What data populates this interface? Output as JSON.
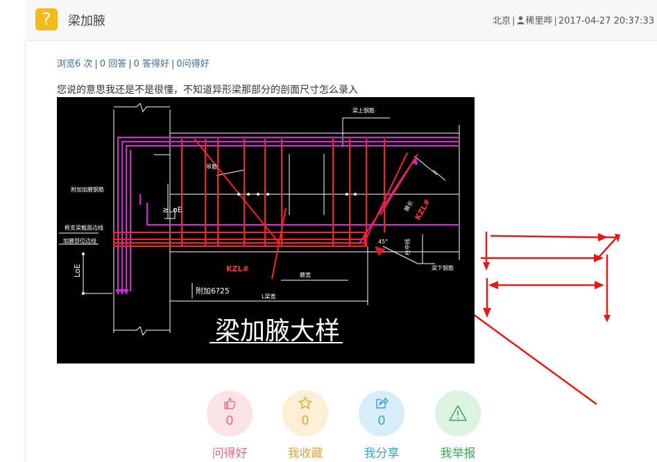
{
  "header": {
    "badge": "?",
    "title": "梁加腋",
    "location": "北京",
    "user": "稀里哗",
    "datetime": "2017-04-27 20:37:33"
  },
  "stats": {
    "views": "浏览6 次",
    "answers": "0 回答",
    "good_answers": "0 答得好",
    "good_questions": "0问得好"
  },
  "answer_text": "您说的意思我还是不是很懂，不知道异形梁那部分的剖面尺寸怎么录入",
  "drawing": {
    "title": "梁加腋大样",
    "labels": {
      "top_rebar": "梁上钢筋",
      "stirrup": "吊筋",
      "add_rebar": "附加加腋钢筋",
      "anchor": "≥LoE",
      "support_edge": "框支梁截面边线",
      "haunch_line": "加腋部位边线",
      "loe": "LoE",
      "kzl_left": "KZL#",
      "kzl_right": "KZL#",
      "haunch_width": "腋宽",
      "haunch_len": "腋长",
      "add_bar": "附加6?25",
      "length": "L梁宽",
      "bottom_rebar": "梁下钢筋",
      "angle": "45°",
      "col": "柱中线"
    }
  },
  "actions": [
    {
      "label": "问得好",
      "count": "0",
      "icon": "thumbs-up-icon",
      "bg": "#fbe2e4",
      "fg": "#e8707e"
    },
    {
      "label": "我收藏",
      "count": "0",
      "icon": "star-icon",
      "bg": "#fcefd4",
      "fg": "#e6a43a"
    },
    {
      "label": "我分享",
      "count": "0",
      "icon": "share-icon",
      "bg": "#d7eefa",
      "fg": "#3aa3d8"
    },
    {
      "label": "我举报",
      "count": "",
      "icon": "warning-icon",
      "bg": "#dcf3e2",
      "fg": "#3ea85a"
    }
  ]
}
